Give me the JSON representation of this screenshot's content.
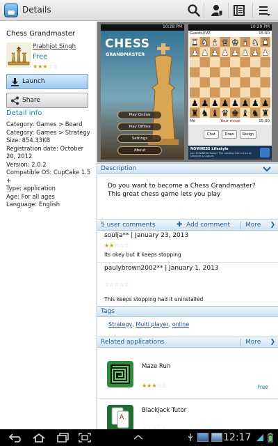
{
  "actionbar": {
    "title": "Details",
    "icons": [
      "search-icon",
      "account-icon",
      "library-icon",
      "menu-icon"
    ]
  },
  "app": {
    "name": "Chess Grandmaster",
    "developer": "Prabhjot Singh",
    "price": "Free",
    "rating_stars": 3,
    "launch_label": "Launch",
    "share_label": "Share"
  },
  "details": {
    "header": "Detail info",
    "lines": [
      "Category: Games > Board",
      "Category: Games > Strategy",
      "Size: 854.33KB",
      "Registration date: October 20, 2012",
      "Version: 2.0.2",
      "Compatible OS: CupCake 1.5 +",
      "Type: application",
      "Age: For all ages",
      "Language: English"
    ]
  },
  "screenshots": {
    "shot1": {
      "clock": "10:28 PM",
      "title_line1": "CHESS",
      "title_line2": "GRANDMASTER",
      "menu": [
        "Play Online",
        "Play Offline",
        "Settings",
        "About"
      ]
    },
    "shot2": {
      "clock": "10:29 PM",
      "player_top": "GuestLVVZ",
      "timer_top": "15:00",
      "player_bottom": "Me",
      "your_move": "Your move",
      "timer_bottom": "15:00",
      "buttons": [
        "Chat",
        "Draw",
        "Resign"
      ],
      "ad_title": "NOWNESS Lifestyle",
      "ad_body": "Join NOWNESS Today! The Leading Site in Luxury Lifestyle & Culture."
    }
  },
  "description": {
    "header": "Description",
    "text_line1": "Do you want to become a Chess Grandmaster?",
    "text_line2": "This great chess game lets you play"
  },
  "comments": {
    "header": "5 user comments",
    "add_label": "Add comment",
    "more_label": "More",
    "items": [
      {
        "author_date": "soulja** | January 23, 2013",
        "stars": 2,
        "text": "Its okey but it keeps stopping"
      },
      {
        "author_date": "paulybrown2002** | January 1, 2013",
        "stars": 0,
        "text": "This keeps stopping had it uninstalled"
      }
    ]
  },
  "tags": {
    "header": "Tags",
    "items": [
      "Strategy",
      "Multi player",
      "online"
    ]
  },
  "related": {
    "header": "Related applications",
    "more_label": "More",
    "items": [
      {
        "name": "Maze Run",
        "stars": 3,
        "price": "Free"
      },
      {
        "name": "Blackjack Tutor",
        "stars": 0,
        "price": ""
      }
    ]
  },
  "system": {
    "clock": "12:17"
  },
  "colors": {
    "accent": "#1a7ad0",
    "section_text": "#1f5f98",
    "star_on": "#c8a000",
    "star_off": "#c9c9c9"
  }
}
